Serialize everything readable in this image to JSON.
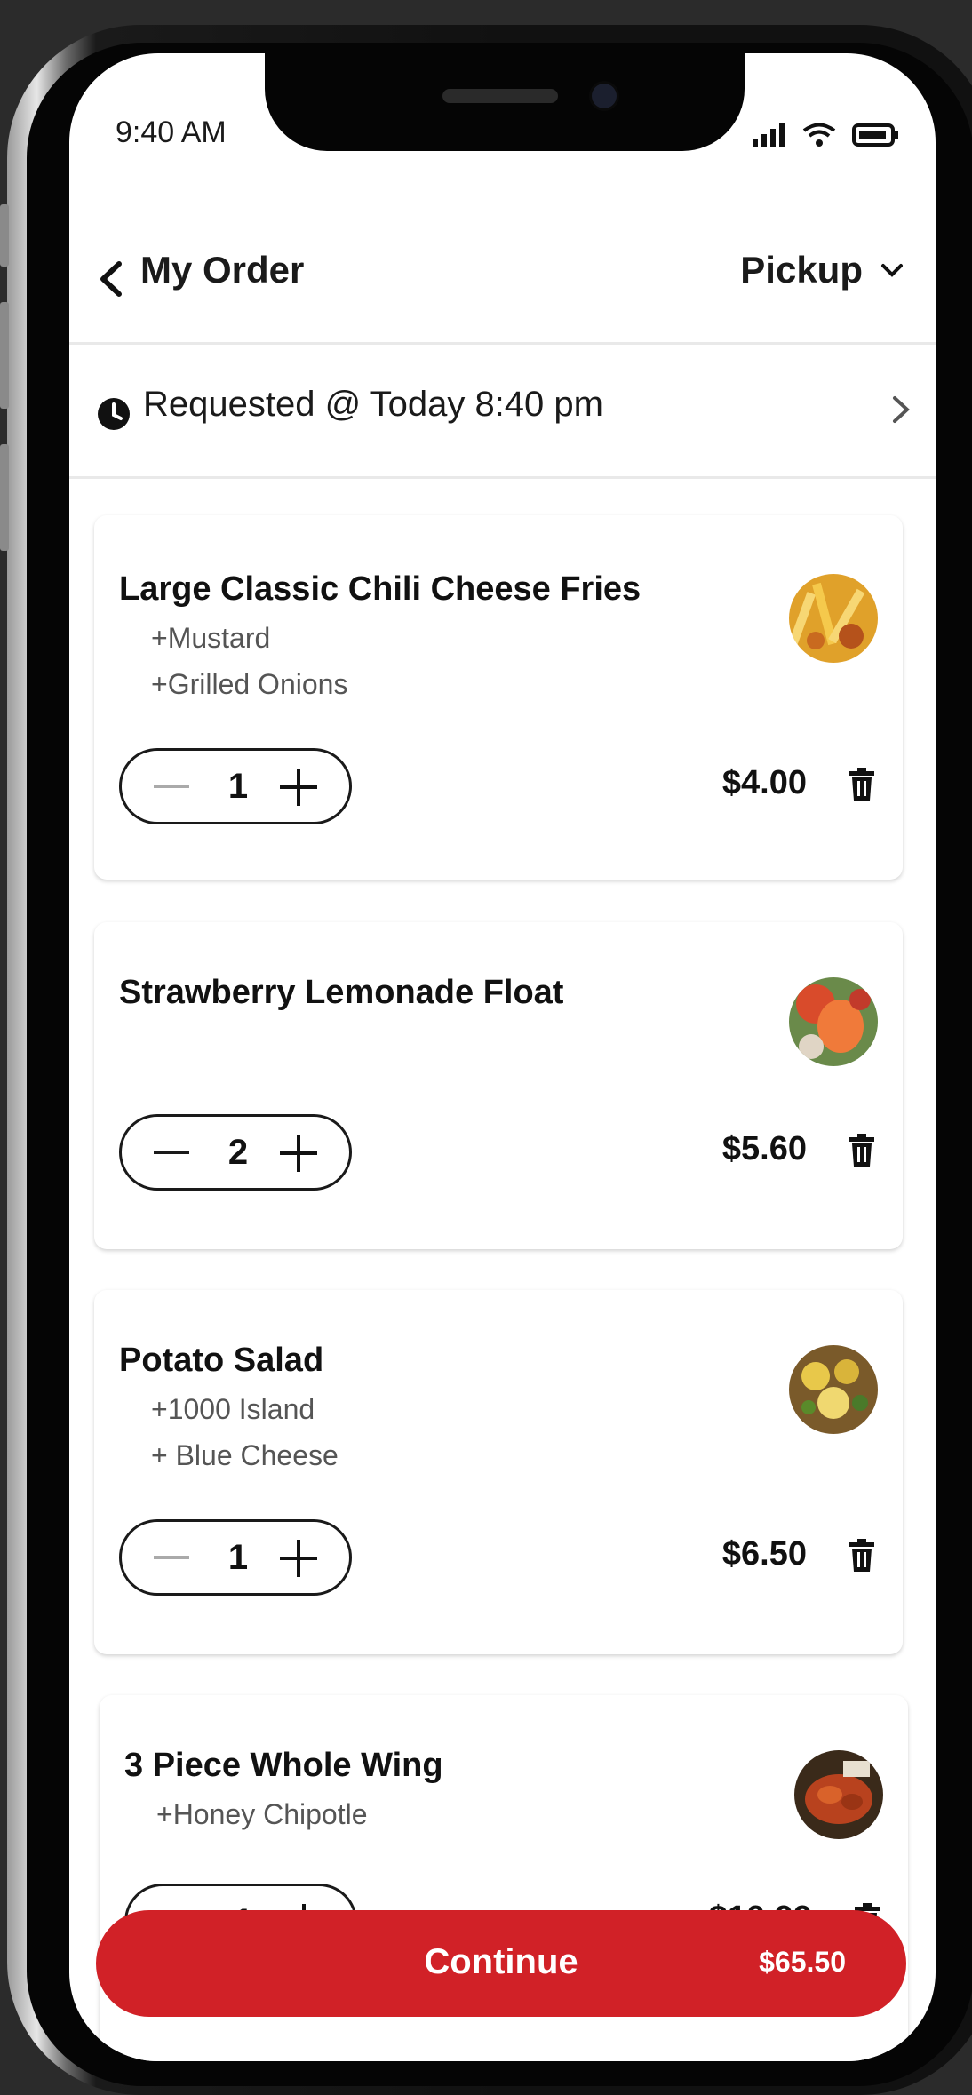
{
  "status_bar": {
    "time": "9:40 AM"
  },
  "header": {
    "title": "My Order",
    "pickup_label": "Pickup"
  },
  "request": {
    "text": "Requested @ Today 8:40 pm"
  },
  "items": [
    {
      "name": "Large Classic Chili Cheese Fries",
      "mods": [
        "+Mustard",
        "+Grilled Onions"
      ],
      "qty": "1",
      "price": "$4.00"
    },
    {
      "name": "Strawberry Lemonade Float",
      "mods": [],
      "qty": "2",
      "price": "$5.60"
    },
    {
      "name": "Potato Salad",
      "mods": [
        "+1000 Island",
        "+ Blue Cheese"
      ],
      "qty": "1",
      "price": "$6.50"
    },
    {
      "name": "3 Piece Whole Wing",
      "mods": [
        "+Honey Chipotle"
      ],
      "qty": "1",
      "price": "$10.99"
    }
  ],
  "footer": {
    "continue_label": "Continue",
    "total": "$65.50"
  },
  "colors": {
    "accent": "#d12127"
  }
}
